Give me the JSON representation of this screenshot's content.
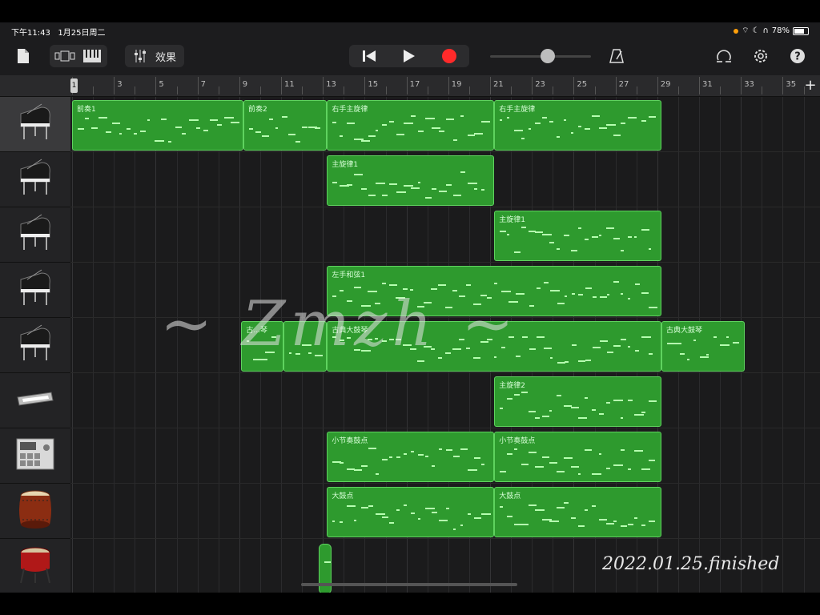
{
  "status": {
    "time": "下午11:43",
    "date": "1月25日周二",
    "battery": "78%"
  },
  "toolbar": {
    "fx_label": "效果"
  },
  "ruler": {
    "labels": [
      "1",
      "3",
      "5",
      "7",
      "9",
      "11",
      "13",
      "15",
      "17",
      "19",
      "21",
      "23",
      "25",
      "27",
      "29",
      "31",
      "33",
      "35"
    ]
  },
  "tracks": [
    {
      "icon": "grand-piano-icon",
      "selected": true
    },
    {
      "icon": "grand-piano-icon"
    },
    {
      "icon": "grand-piano-icon"
    },
    {
      "icon": "grand-piano-icon"
    },
    {
      "icon": "grand-piano-icon"
    },
    {
      "icon": "keyboard-synth-icon"
    },
    {
      "icon": "drum-machine-icon"
    },
    {
      "icon": "taiko-drum-icon"
    },
    {
      "icon": "bass-drum-icon"
    }
  ],
  "regions": [
    {
      "track": 0,
      "start": 1,
      "end": 9.2,
      "label": "前奏1"
    },
    {
      "track": 0,
      "start": 9.2,
      "end": 13.2,
      "label": "前奏2"
    },
    {
      "track": 0,
      "start": 13.2,
      "end": 21.2,
      "label": "右手主旋律"
    },
    {
      "track": 0,
      "start": 21.2,
      "end": 29.2,
      "label": "右手主旋律"
    },
    {
      "track": 1,
      "start": 13.2,
      "end": 21.2,
      "label": "主旋律1"
    },
    {
      "track": 2,
      "start": 21.2,
      "end": 29.2,
      "label": "主旋律1"
    },
    {
      "track": 3,
      "start": 13.2,
      "end": 29.2,
      "label": "左手和弦1"
    },
    {
      "track": 4,
      "start": 9.1,
      "end": 11.1,
      "label": "古...琴"
    },
    {
      "track": 4,
      "start": 11.1,
      "end": 13.2,
      "label": ""
    },
    {
      "track": 4,
      "start": 13.2,
      "end": 29.2,
      "label": "古典大鼓琴"
    },
    {
      "track": 4,
      "start": 29.2,
      "end": 33.2,
      "label": "古典大鼓琴"
    },
    {
      "track": 5,
      "start": 21.2,
      "end": 29.2,
      "label": "主旋律2"
    },
    {
      "track": 6,
      "start": 13.2,
      "end": 21.2,
      "label": "小节奏鼓点"
    },
    {
      "track": 6,
      "start": 21.2,
      "end": 29.2,
      "label": "小节奏鼓点"
    },
    {
      "track": 7,
      "start": 13.2,
      "end": 21.2,
      "label": "大鼓点"
    },
    {
      "track": 7,
      "start": 21.2,
      "end": 29.2,
      "label": "大鼓点"
    },
    {
      "track": 8,
      "start": 12.8,
      "end": 13.4,
      "label": ""
    }
  ],
  "watermark": {
    "text": "~ Zmzh ~"
  },
  "footer": {
    "finished_text": "2022.01.25.finished"
  }
}
